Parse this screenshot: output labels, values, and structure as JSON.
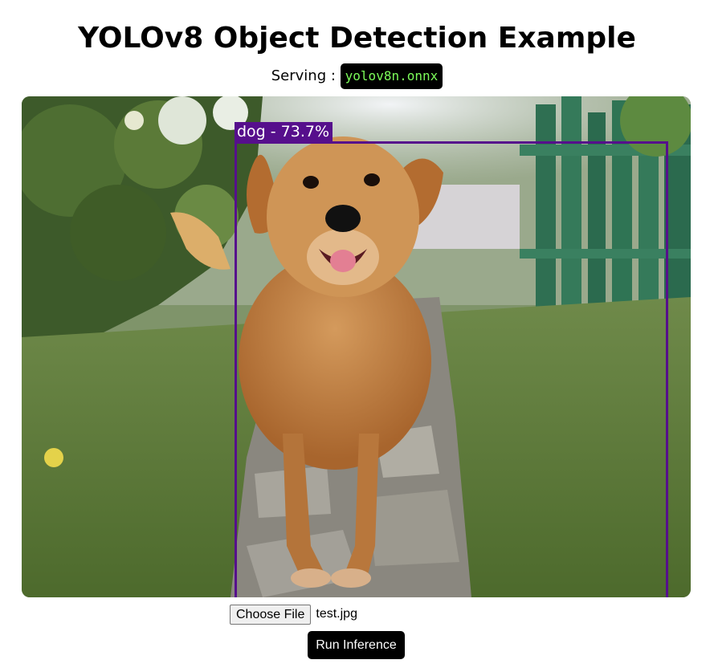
{
  "header": {
    "title": "YOLOv8 Object Detection Example",
    "serving_label": "Serving :",
    "model_name": "yolov8n.onnx"
  },
  "result_image": {
    "detections": [
      {
        "label": "dog - 73.7%",
        "box_color": "#560f8c"
      }
    ]
  },
  "controls": {
    "choose_file_label": "Choose File",
    "selected_file": "test.jpg",
    "run_button_label": "Run Inference"
  },
  "colors": {
    "model_tag_bg": "#000000",
    "model_tag_text": "#7cfc5a",
    "box": "#560f8c",
    "button_bg": "#000000",
    "button_text": "#ffffff"
  }
}
